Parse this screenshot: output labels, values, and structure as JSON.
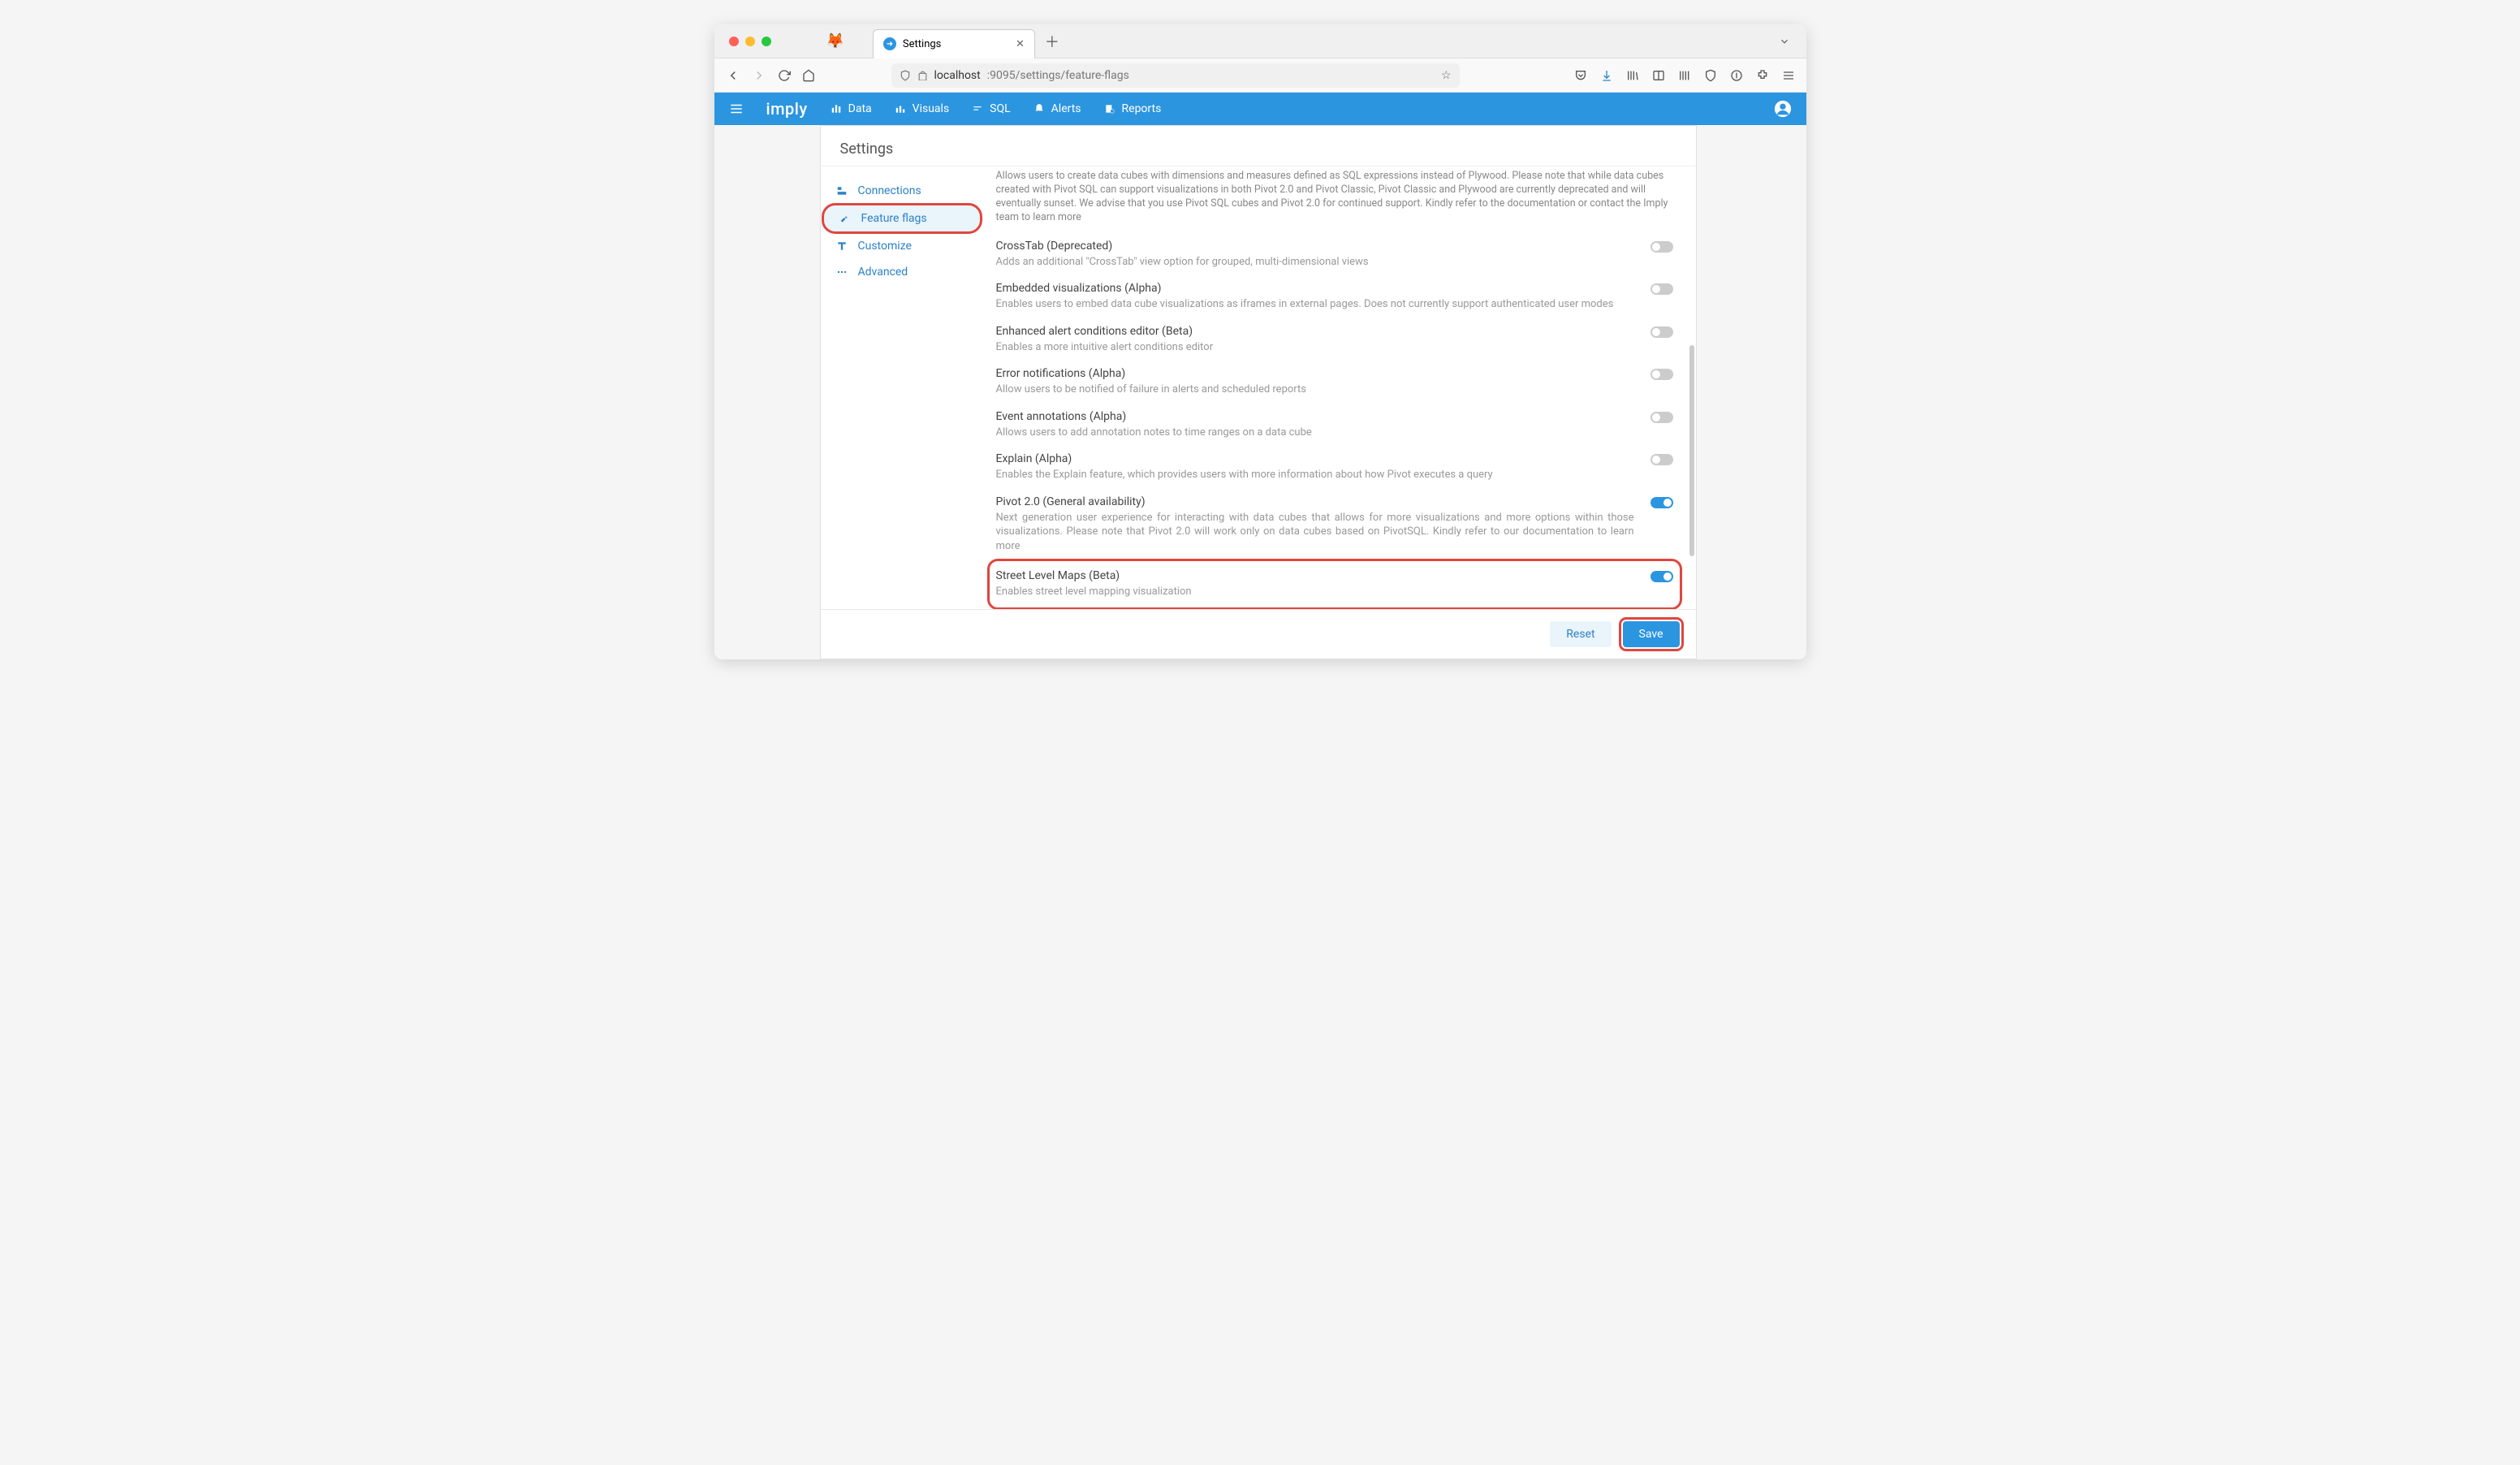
{
  "browser": {
    "tab_title": "Settings",
    "url_host": "localhost",
    "url_port_path": ":9095/settings/feature-flags"
  },
  "app_nav": {
    "brand": "imply",
    "items": [
      {
        "label": "Data"
      },
      {
        "label": "Visuals"
      },
      {
        "label": "SQL"
      },
      {
        "label": "Alerts"
      },
      {
        "label": "Reports"
      }
    ]
  },
  "page_title": "Settings",
  "sidebar": {
    "items": [
      {
        "label": "Connections"
      },
      {
        "label": "Feature flags"
      },
      {
        "label": "Customize"
      },
      {
        "label": "Advanced"
      }
    ]
  },
  "intro": "Allows users to create data cubes with dimensions and measures defined as SQL expressions instead of Plywood. Please note that while data cubes created with Pivot SQL can support visualizations in both Pivot 2.0 and Pivot Classic, Pivot Classic and Plywood are currently deprecated and will eventually sunset. We advise that you use Pivot SQL cubes and Pivot 2.0 for continued support. Kindly refer to the documentation or contact the Imply team to learn more",
  "flags": [
    {
      "title": "CrossTab (Deprecated)",
      "desc": "Adds an additional \"CrossTab\" view option for grouped, multi-dimensional views",
      "on": false
    },
    {
      "title": "Embedded visualizations (Alpha)",
      "desc": "Enables users to embed data cube visualizations as iframes in external pages. Does not currently support authenticated user modes",
      "on": false
    },
    {
      "title": "Enhanced alert conditions editor (Beta)",
      "desc": "Enables a more intuitive alert conditions editor",
      "on": false
    },
    {
      "title": "Error notifications (Alpha)",
      "desc": "Allow users to be notified of failure in alerts and scheduled reports",
      "on": false
    },
    {
      "title": "Event annotations (Alpha)",
      "desc": "Allows users to add annotation notes to time ranges on a data cube",
      "on": false
    },
    {
      "title": "Explain (Alpha)",
      "desc": "Enables the Explain feature, which provides users with more information about how Pivot executes a query",
      "on": false
    },
    {
      "title": "Pivot 2.0 (General availability)",
      "desc": "Next generation user experience for interacting with data cubes that allows for more visualizations and more options within those visualizations. Please note that Pivot 2.0 will work only on data cubes based on PivotSQL. Kindly refer to our documentation to learn more",
      "on": true
    },
    {
      "title": "Street Level Maps (Beta)",
      "desc": "Enables street level mapping visualization",
      "on": true,
      "highlighted": true
    }
  ],
  "footer": {
    "reset": "Reset",
    "save": "Save"
  }
}
